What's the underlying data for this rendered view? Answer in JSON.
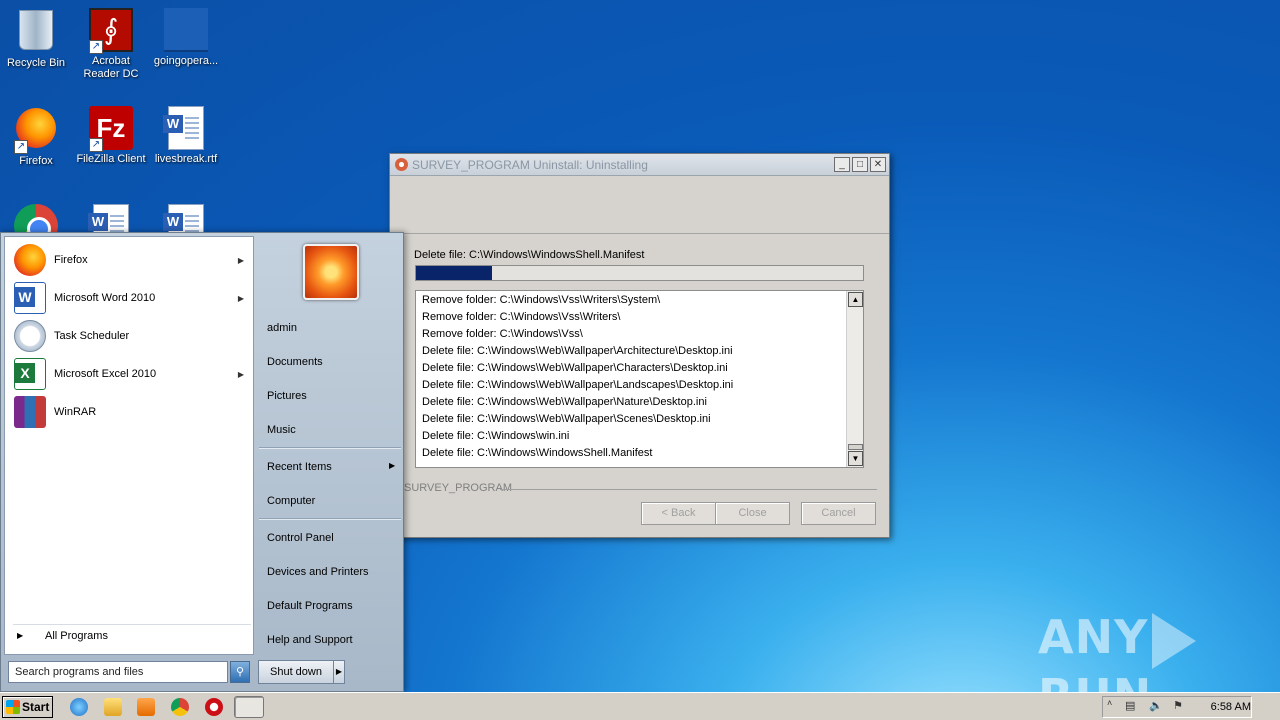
{
  "desktop": {
    "icons": [
      {
        "label": "Recycle Bin",
        "icon": "recycle-bin-icon"
      },
      {
        "label": "Acrobat Reader DC",
        "icon": "acrobat-icon"
      },
      {
        "label": "goingopera...",
        "icon": "file-icon"
      },
      {
        "label": "Firefox",
        "icon": "firefox-icon"
      },
      {
        "label": "FileZilla Client",
        "icon": "filezilla-icon"
      },
      {
        "label": "livesbreak.rtf",
        "icon": "word-document-icon"
      }
    ]
  },
  "installer": {
    "title": "SURVEY_PROGRAM Uninstall: Uninstalling",
    "status": "Delete file: C:\\Windows\\WindowsShell.Manifest",
    "progress_percent": 17,
    "log": [
      "Remove folder: C:\\Windows\\Vss\\Writers\\System\\",
      "Remove folder: C:\\Windows\\Vss\\Writers\\",
      "Remove folder: C:\\Windows\\Vss\\",
      "Delete file: C:\\Windows\\Web\\Wallpaper\\Architecture\\Desktop.ini",
      "Delete file: C:\\Windows\\Web\\Wallpaper\\Characters\\Desktop.ini",
      "Delete file: C:\\Windows\\Web\\Wallpaper\\Landscapes\\Desktop.ini",
      "Delete file: C:\\Windows\\Web\\Wallpaper\\Nature\\Desktop.ini",
      "Delete file: C:\\Windows\\Web\\Wallpaper\\Scenes\\Desktop.ini",
      "Delete file: C:\\Windows\\win.ini",
      "Delete file: C:\\Windows\\WindowsShell.Manifest"
    ],
    "branding": "SURVEY_PROGRAM",
    "buttons": {
      "back": "< Back",
      "close": "Close",
      "cancel": "Cancel"
    }
  },
  "start_menu": {
    "programs": [
      {
        "label": "Firefox",
        "has_submenu": true
      },
      {
        "label": "Microsoft Word 2010",
        "has_submenu": true
      },
      {
        "label": "Task Scheduler",
        "has_submenu": false
      },
      {
        "label": "Microsoft Excel 2010",
        "has_submenu": true
      },
      {
        "label": "WinRAR",
        "has_submenu": false
      }
    ],
    "all_programs": "All Programs",
    "search_placeholder": "Search programs and files",
    "right_links": {
      "user": "admin",
      "documents": "Documents",
      "pictures": "Pictures",
      "music": "Music",
      "recent_items": "Recent Items",
      "computer": "Computer",
      "control_panel": "Control Panel",
      "devices_printers": "Devices and Printers",
      "default_programs": "Default Programs",
      "help_support": "Help and Support"
    },
    "shutdown": "Shut down"
  },
  "taskbar": {
    "start_label": "Start",
    "clock": "6:58 AM"
  },
  "watermark": {
    "left": "ANY",
    "right": "RUN"
  }
}
